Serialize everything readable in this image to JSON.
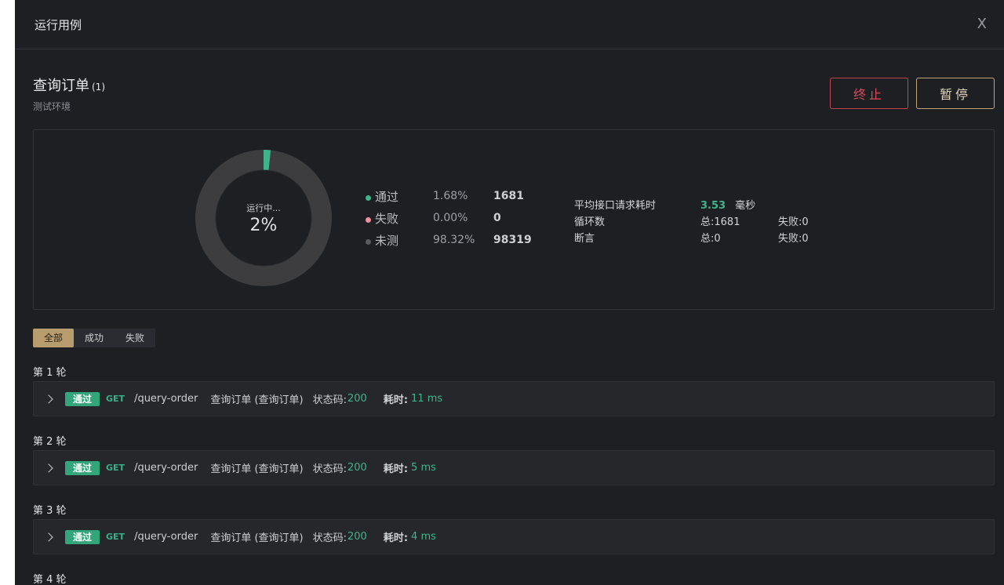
{
  "header": {
    "title": "运行用例",
    "close_glyph": "X"
  },
  "summary": {
    "name": "查询订单",
    "count": "(1)",
    "environment": "测试环境",
    "buttons": {
      "stop": "终止",
      "pause": "暂停"
    },
    "donut": {
      "status": "运行中...",
      "percent_label": "2%",
      "progress": 0.0168
    },
    "legend": [
      {
        "name": "通过",
        "pct": "1.68%",
        "count": "1681",
        "color": "#3fb38a"
      },
      {
        "name": "失败",
        "pct": "0.00%",
        "count": "0",
        "color": "#f08fa1"
      },
      {
        "name": "未测",
        "pct": "98.32%",
        "count": "98319",
        "color": "#5a5a5e"
      }
    ],
    "metrics": [
      {
        "label": "平均接口请求耗时",
        "value_num": "3.53",
        "value": "毫秒",
        "extra": ""
      },
      {
        "label": "循环数",
        "value_num": "",
        "value": "总:1681",
        "extra": "失败:0"
      },
      {
        "label": "断言",
        "value_num": "",
        "value": "总:0",
        "extra": "失败:0"
      }
    ]
  },
  "filters": {
    "all": "全部",
    "success": "成功",
    "fail": "失败"
  },
  "rounds": [
    {
      "label": "第 1 轮",
      "badge": "通过",
      "method": "GET",
      "path": "/query-order",
      "desc": "查询订单 (查询订单)",
      "status_label": "状态码:",
      "status_code": "200",
      "time_label": "耗时:",
      "time": "11 ms"
    },
    {
      "label": "第 2 轮",
      "badge": "通过",
      "method": "GET",
      "path": "/query-order",
      "desc": "查询订单 (查询订单)",
      "status_label": "状态码:",
      "status_code": "200",
      "time_label": "耗时:",
      "time": "5 ms"
    },
    {
      "label": "第 3 轮",
      "badge": "通过",
      "method": "GET",
      "path": "/query-order",
      "desc": "查询订单 (查询订单)",
      "status_label": "状态码:",
      "status_code": "200",
      "time_label": "耗时:",
      "time": "4 ms"
    },
    {
      "label": "第 4 轮"
    }
  ],
  "colors": {
    "background": "#1e1f23",
    "accent_green": "#40b48a",
    "stop_red": "#d74a58",
    "pause_gold": "#bfa77a"
  }
}
